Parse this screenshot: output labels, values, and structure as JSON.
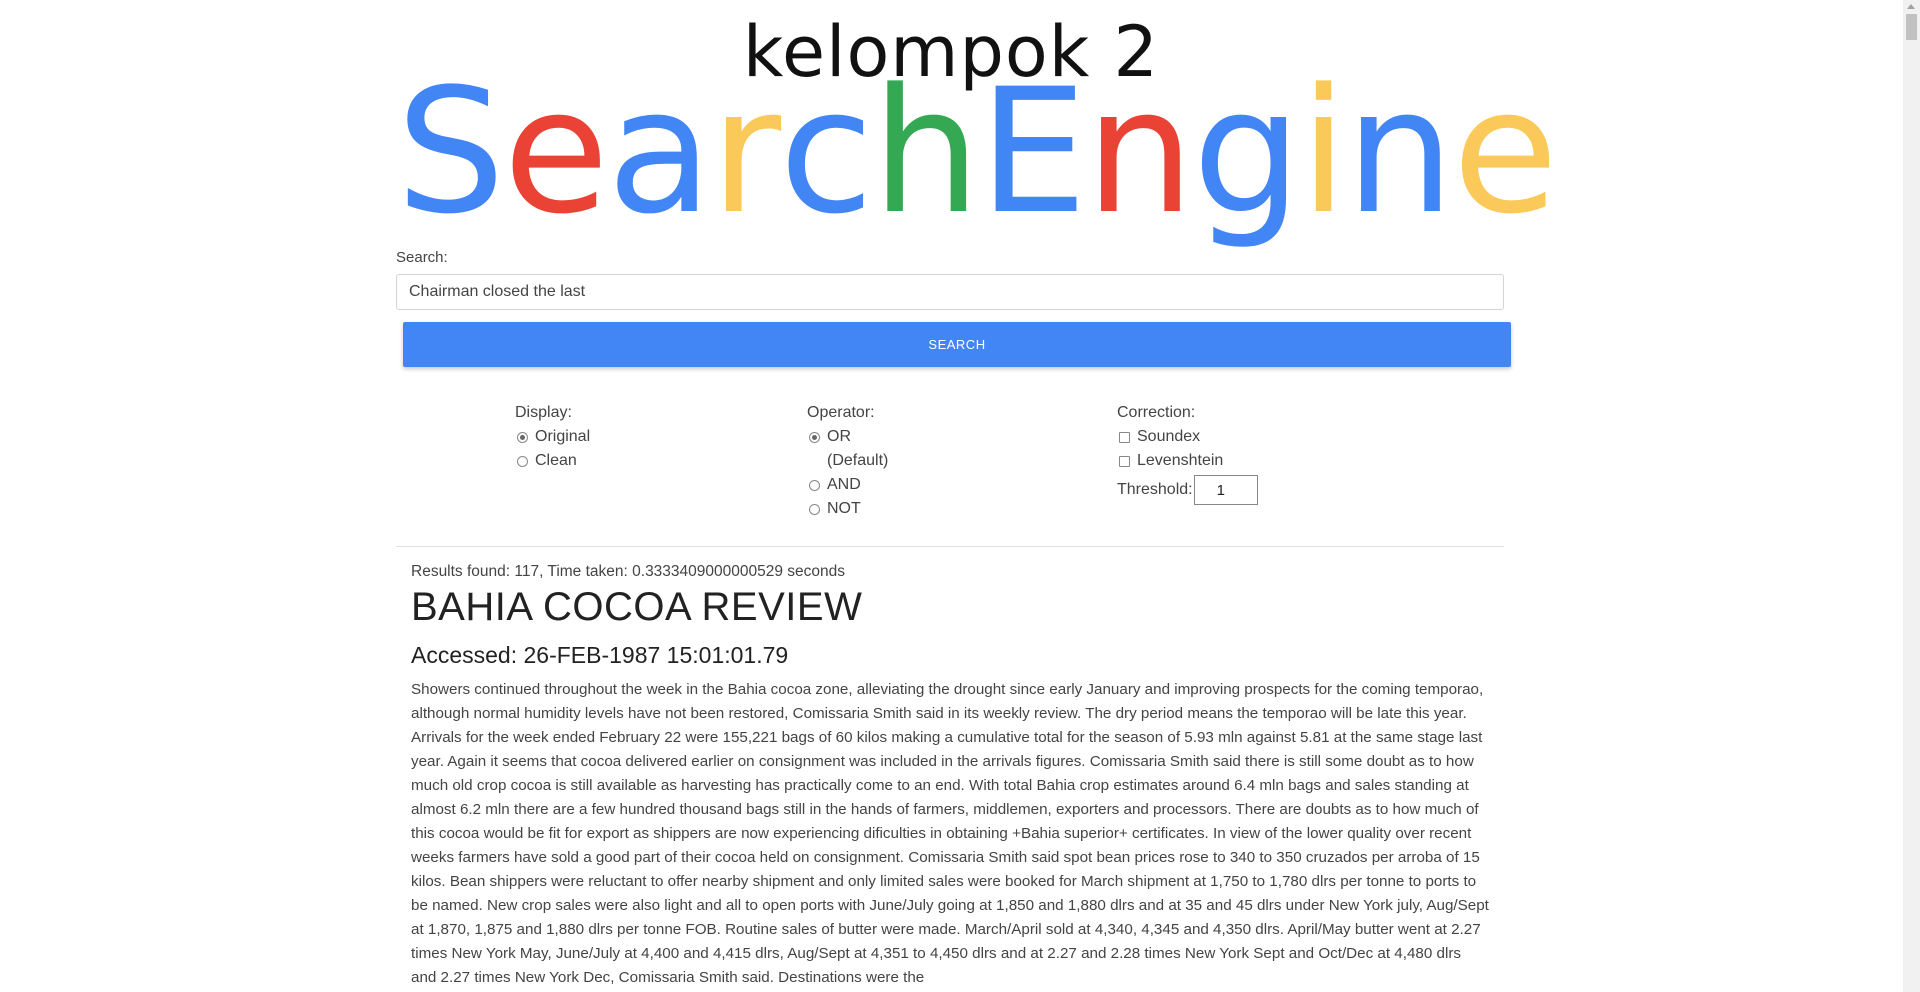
{
  "logo": {
    "subtitle": "kelompok 2",
    "letters": [
      {
        "char": "S",
        "color": "#4285f4"
      },
      {
        "char": "e",
        "color": "#ea4335"
      },
      {
        "char": "a",
        "color": "#4285f4"
      },
      {
        "char": "r",
        "color": "#fbc95a"
      },
      {
        "char": "c",
        "color": "#4285f4"
      },
      {
        "char": "h",
        "color": "#34a853"
      },
      {
        "char": "E",
        "color": "#4285f4"
      },
      {
        "char": "n",
        "color": "#ea4335"
      },
      {
        "char": "g",
        "color": "#4285f4"
      },
      {
        "char": "i",
        "color": "#fbc95a"
      },
      {
        "char": "n",
        "color": "#4285f4"
      },
      {
        "char": "e",
        "color": "#fbc95a"
      }
    ]
  },
  "search": {
    "label": "Search:",
    "value": "Chairman closed the last",
    "button_label": "SEARCH"
  },
  "options": {
    "display": {
      "title": "Display:",
      "items": [
        {
          "label": "Original",
          "checked": true
        },
        {
          "label": "Clean",
          "checked": false
        }
      ]
    },
    "operator": {
      "title": "Operator:",
      "items": [
        {
          "label": "OR",
          "sub": "(Default)",
          "checked": true
        },
        {
          "label": "AND",
          "checked": false
        },
        {
          "label": "NOT",
          "checked": false
        }
      ]
    },
    "correction": {
      "title": "Correction:",
      "items": [
        {
          "label": "Soundex",
          "checked": false
        },
        {
          "label": "Levenshtein",
          "checked": false
        }
      ],
      "threshold_label": "Threshold:",
      "threshold_value": "1"
    }
  },
  "results": {
    "info": "Results found: 117, Time taken: 0.3333409000000529 seconds",
    "doc": {
      "title": "BAHIA COCOA REVIEW",
      "accessed": "Accessed: 26-FEB-1987 15:01:01.79",
      "body": "Showers continued throughout the week in the Bahia cocoa zone, alleviating the drought since early January and improving prospects for the coming temporao, although normal humidity levels have not been restored, Comissaria Smith said in its weekly review. The dry period means the temporao will be late this year. Arrivals for the week ended February 22 were 155,221 bags of 60 kilos making a cumulative total for the season of 5.93 mln against 5.81 at the same stage last year. Again it seems that cocoa delivered earlier on consignment was included in the arrivals figures. Comissaria Smith said there is still some doubt as to how much old crop cocoa is still available as harvesting has practically come to an end. With total Bahia crop estimates around 6.4 mln bags and sales standing at almost 6.2 mln there are a few hundred thousand bags still in the hands of farmers, middlemen, exporters and processors. There are doubts as to how much of this cocoa would be fit for export as shippers are now experiencing dificulties in obtaining +Bahia superior+ certificates. In view of the lower quality over recent weeks farmers have sold a good part of their cocoa held on consignment. Comissaria Smith said spot bean prices rose to 340 to 350 cruzados per arroba of 15 kilos. Bean shippers were reluctant to offer nearby shipment and only limited sales were booked for March shipment at 1,750 to 1,780 dlrs per tonne to ports to be named. New crop sales were also light and all to open ports with June/July going at 1,850 and 1,880 dlrs and at 35 and 45 dlrs under New York july, Aug/Sept at 1,870, 1,875 and 1,880 dlrs per tonne FOB. Routine sales of butter were made. March/April sold at 4,340, 4,345 and 4,350 dlrs. April/May butter went at 2.27 times New York May, June/July at 4,400 and 4,415 dlrs, Aug/Sept at 4,351 to 4,450 dlrs and at 2.27 and 2.28 times New York Sept and Oct/Dec at 4,480 dlrs and 2.27 times New York Dec, Comissaria Smith said. Destinations were the"
    }
  }
}
